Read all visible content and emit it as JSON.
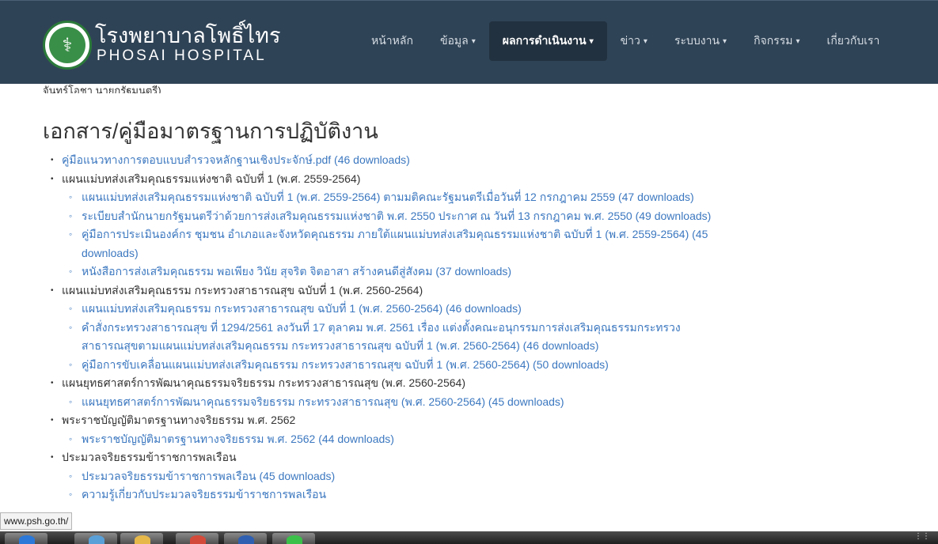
{
  "header": {
    "brand_th": "โรงพยาบาลโพธิ์ไทร",
    "brand_en": "PHOSAI HOSPITAL",
    "menu": [
      {
        "label": "หน้าหลัก",
        "dropdown": false,
        "active": false
      },
      {
        "label": "ข้อมูล",
        "dropdown": true,
        "active": false
      },
      {
        "label": "ผลการดำเนินงาน",
        "dropdown": true,
        "active": true
      },
      {
        "label": "ข่าว",
        "dropdown": true,
        "active": false
      },
      {
        "label": "ระบบงาน",
        "dropdown": true,
        "active": false
      },
      {
        "label": "กิจกรรม",
        "dropdown": true,
        "active": false
      },
      {
        "label": "เกี่ยวกับเรา",
        "dropdown": false,
        "active": false
      }
    ]
  },
  "content": {
    "cut_line": "จันทร์โอชา นายกรัฐมนตรี)",
    "heading": "เอกสาร/คู่มือมาตรฐานการปฏิบัติงาน",
    "items": [
      {
        "text": "",
        "link": "คู่มือแนวทางการตอบแบบสำรวจหลักฐานเชิงประจักษ์.pdf (46 downloads)",
        "children": []
      },
      {
        "text": "แผนแม่บทส่งเสริมคุณธรรมแห่งชาติ ฉบับที่ 1 (พ.ศ. 2559-2564)",
        "link": "",
        "children": [
          "แผนแม่บทส่งเสริมคุณธรรมแห่งชาติ ฉบับที่ 1 (พ.ศ. 2559-2564) ตามมติคณะรัฐมนตรีเมื่อวันที่ 12 กรกฎาคม 2559 (47 downloads)",
          "ระเบียบสำนักนายกรัฐมนตรีว่าด้วยการส่งเสริมคุณธรรมแห่งชาติ พ.ศ. 2550 ประกาศ ณ วันที่ 13 กรกฎาคม พ.ศ. 2550 (49 downloads)",
          "คู่มือการประเมินองค์กร ชุมชน อำเภอและจังหวัดคุณธรรม ภายใต้แผนแม่บทส่งเสริมคุณธรรมแห่งชาติ ฉบับที่ 1 (พ.ศ. 2559-2564) (45 downloads)",
          "หนังสือการส่งเสริมคุณธรรม พอเพียง วินัย สุจริต จิตอาสา สร้างคนดีสู่สังคม (37 downloads)"
        ]
      },
      {
        "text": "แผนแม่บทส่งเสริมคุณธรรม กระทรวงสาธารณสุข ฉบับที่ 1 (พ.ศ. 2560-2564)",
        "link": "",
        "children": [
          "แผนแม่บทส่งเสริมคุณธรรม กระทรวงสาธารณสุข ฉบับที่ 1 (พ.ศ. 2560-2564) (46 downloads)",
          "คำสั่งกระทรวงสาธารณสุข ที่ 1294/2561 ลงวันที่ 17 ตุลาคม พ.ศ. 2561 เรื่อง แต่งตั้งคณะอนุกรรมการส่งเสริมคุณธรรมกระทรวงสาธารณสุขตามแผนแม่บทส่งเสริมคุณธรรม กระทรวงสาธารณสุข ฉบับที่ 1 (พ.ศ. 2560-2564) (46 downloads)",
          "คู่มือการขับเคลื่อนแผนแม่บทส่งเสริมคุณธรรม กระทรวงสาธารณสุข ฉบับที่ 1 (พ.ศ. 2560-2564) (50 downloads)"
        ]
      },
      {
        "text": "แผนยุทธศาสตร์การพัฒนาคุณธรรมจริยธรรม กระทรวงสาธารณสุข (พ.ศ. 2560-2564)",
        "link": "",
        "children": [
          "แผนยุทธศาสตร์การพัฒนาคุณธรรมจริยธรรม กระทรวงสาธารณสุข (พ.ศ. 2560-2564) (45 downloads)"
        ]
      },
      {
        "text": "พระราชบัญญัติมาตรฐานทางจริยธรรม พ.ศ. 2562",
        "link": "",
        "children": [
          "พระราชบัญญัติมาตรฐานทางจริยธรรม พ.ศ. 2562 (44 downloads)"
        ]
      },
      {
        "text": "ประมวลจริยธรรมข้าราชการพลเรือน",
        "link": "",
        "children": [
          "ประมวลจริยธรรมข้าราชการพลเรือน (45 downloads)",
          "ความรู้เกี่ยวกับประมวลจริยธรรมข้าราชการพลเรือน"
        ]
      }
    ]
  },
  "status_url": "www.psh.go.th/",
  "taskbar": {
    "buttons": [
      "ie-icon",
      "app-icon",
      "folder-icon",
      "chrome-icon",
      "word-icon",
      "line-icon"
    ],
    "colors": [
      "#2b78d8",
      "#5aa0d8",
      "#e6b84a",
      "#d44a3a",
      "#2f5fb0",
      "#3bc14a"
    ]
  }
}
